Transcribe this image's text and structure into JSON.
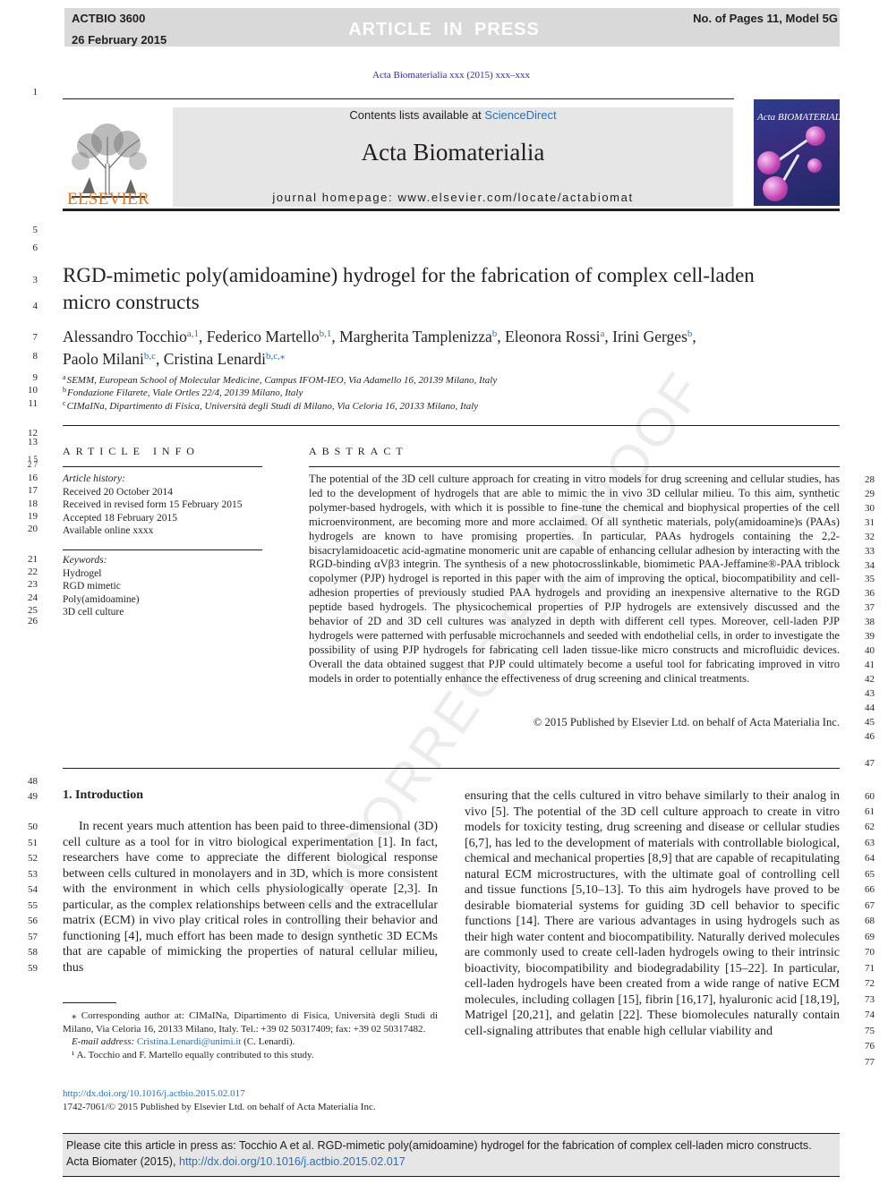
{
  "press_header": {
    "article_code": "ACTBIO 3600",
    "date": "26 February 2015",
    "status": "ARTICLE IN PRESS",
    "pages": "No. of Pages 11, Model 5G"
  },
  "journal_ref": "Acta Biomaterialia xxx (2015) xxx–xxx",
  "masthead": {
    "contents_prefix": "Contents lists available at ",
    "contents_link": "ScienceDirect",
    "journal_name": "Acta Biomaterialia",
    "homepage_prefix": "journal homepage: ",
    "homepage_url": "www.elsevier.com/locate/actabiomat",
    "publisher": "ELSEVIER",
    "cover_title": "Acta BIOMATERIALIA"
  },
  "title": "RGD-mimetic poly(amidoamine) hydrogel for the fabrication of complex cell-laden micro constructs",
  "authors": [
    {
      "name": "Alessandro Tocchio",
      "sup": "a,1"
    },
    {
      "name": "Federico Martello",
      "sup": "b,1"
    },
    {
      "name": "Margherita Tamplenizza",
      "sup": "b"
    },
    {
      "name": "Eleonora Rossi",
      "sup": "a"
    },
    {
      "name": "Irini Gerges",
      "sup": "b"
    },
    {
      "name": "Paolo Milani",
      "sup": "b,c"
    },
    {
      "name": "Cristina Lenardi",
      "sup": "b,c,⁎"
    }
  ],
  "affiliations": [
    {
      "sup": "a",
      "text": "SEMM, European School of Molecular Medicine, Campus IFOM-IEO, Via Adamello 16, 20139 Milano, Italy"
    },
    {
      "sup": "b",
      "text": "Fondazione Filarete, Viale Ortles 22/4, 20139 Milano, Italy"
    },
    {
      "sup": "c",
      "text": "CIMaINa, Dipartimento di Fisica, Università degli Studi di Milano, Via Celoria 16, 20133 Milano, Italy"
    }
  ],
  "article_info": {
    "heading": "ARTICLE INFO",
    "history_label": "Article history:",
    "history": [
      "Received 20 October 2014",
      "Received in revised form 15 February 2015",
      "Accepted 18 February 2015",
      "Available online xxxx"
    ],
    "keywords_label": "Keywords:",
    "keywords": [
      "Hydrogel",
      "RGD mimetic",
      "Poly(amidoamine)",
      "3D cell culture"
    ]
  },
  "abstract": {
    "heading": "ABSTRACT",
    "text": "The potential of the 3D cell culture approach for creating in vitro models for drug screening and cellular studies, has led to the development of hydrogels that are able to mimic the in vivo 3D cellular milieu. To this aim, synthetic polymer-based hydrogels, with which it is possible to fine-tune the chemical and biophysical properties of the cell microenvironment, are becoming more and more acclaimed. Of all synthetic materials, poly(amidoamine)s (PAAs) hydrogels are known to have promising properties. In particular, PAAs hydrogels containing the 2,2-bisacrylamidoacetic acid-agmatine monomeric unit are capable of enhancing cellular adhesion by interacting with the RGD-binding αVβ3 integrin. The synthesis of a new photocrosslinkable, biomimetic PAA-Jeffamine®-PAA triblock copolymer (PJP) hydrogel is reported in this paper with the aim of improving the optical, biocompatibility and cell-adhesion properties of previously studied PAA hydrogels and providing an inexpensive alternative to the RGD peptide based hydrogels. The physicochemical properties of PJP hydrogels are extensively discussed and the behavior of 2D and 3D cell cultures was analyzed in depth with different cell types. Moreover, cell-laden PJP hydrogels were patterned with perfusable microchannels and seeded with endothelial cells, in order to investigate the possibility of using PJP hydrogels for fabricating cell laden tissue-like micro constructs and microfluidic devices. Overall the data obtained suggest that PJP could ultimately become a useful tool for fabricating improved in vitro models in order to potentially enhance the effectiveness of drug screening and clinical treatments.",
    "copyright": "© 2015 Published by Elsevier Ltd. on behalf of Acta Materialia Inc."
  },
  "intro": {
    "heading": "1. Introduction",
    "left_paragraph": "In recent years much attention has been paid to three-dimensional (3D) cell culture as a tool for in vitro biological experimentation [1]. In fact, researchers have come to appreciate the different biological response between cells cultured in monolayers and in 3D, which is more consistent with the environment in which cells physiologically operate [2,3]. In particular, as the complex relationships between cells and the extracellular matrix (ECM) in vivo play critical roles in controlling their behavior and functioning [4], much effort has been made to design synthetic 3D ECMs that are capable of mimicking the properties of natural cellular milieu, thus",
    "right_paragraph": "ensuring that the cells cultured in vitro behave similarly to their analog in vivo [5]. The potential of the 3D cell culture approach to create in vitro models for toxicity testing, drug screening and disease or cellular studies [6,7], has led to the development of materials with controllable biological, chemical and mechanical properties [8,9] that are capable of recapitulating natural ECM microstructures, with the ultimate goal of controlling cell and tissue functions [5,10–13]. To this aim hydrogels have proved to be desirable biomaterial systems for guiding 3D cell behavior to specific functions [14]. There are various advantages in using hydrogels such as their high water content and biocompatibility. Naturally derived molecules are commonly used to create cell-laden hydrogels owing to their intrinsic bioactivity, biocompatibility and biodegradability [15–22]. In particular, cell-laden hydrogels have been created from a wide range of native ECM molecules, including collagen [15], fibrin [16,17], hyaluronic acid [18,19], Matrigel [20,21], and gelatin [22]. These biomolecules naturally contain cell-signaling attributes that enable high cellular viability and"
  },
  "footnotes": {
    "corresponding": "⁎ Corresponding author at: CIMaINa, Dipartimento di Fisica, Università degli Studi di Milano, Via Celoria 16, 20133 Milano, Italy. Tel.: +39 02 50317409; fax: +39 02 50317482.",
    "email_label": "E-mail address: ",
    "email": "Cristina.Lenardi@unimi.it",
    "email_suffix": " (C. Lenardi).",
    "equal": "¹ A. Tocchio and F. Martello equally contributed to this study."
  },
  "doi": "http://dx.doi.org/10.1016/j.actbio.2015.02.017",
  "issn": "1742-7061/© 2015 Published by Elsevier Ltd. on behalf of Acta Materialia Inc.",
  "cite_box": {
    "line1": "Please cite this article in press as: Tocchio A et al. RGD-mimetic poly(amidoamine) hydrogel for the fabrication of complex cell-laden micro constructs.",
    "line2_prefix": "Acta Biomater (2015), ",
    "line2_link": "http://dx.doi.org/10.1016/j.actbio.2015.02.017"
  },
  "watermark": "UNCORRECTED PROOF",
  "line_numbers": {
    "left": [
      "1",
      "5",
      "6",
      "3",
      "4",
      "7",
      "8",
      "9",
      "10",
      "11",
      "12",
      "13",
      "1 5",
      "2 7",
      "16",
      "17",
      "18",
      "19",
      "20",
      "21",
      "22",
      "23",
      "24",
      "25",
      "26",
      "48",
      "49",
      "50",
      "51",
      "52",
      "53",
      "54",
      "55",
      "56",
      "57",
      "58",
      "59"
    ],
    "right": [
      "28",
      "29",
      "30",
      "31",
      "32",
      "33",
      "34",
      "35",
      "36",
      "37",
      "38",
      "39",
      "40",
      "41",
      "42",
      "43",
      "44",
      "45",
      "46",
      "47",
      "60",
      "61",
      "62",
      "63",
      "64",
      "65",
      "66",
      "67",
      "68",
      "69",
      "70",
      "71",
      "72",
      "73",
      "74",
      "75",
      "76",
      "77"
    ]
  }
}
